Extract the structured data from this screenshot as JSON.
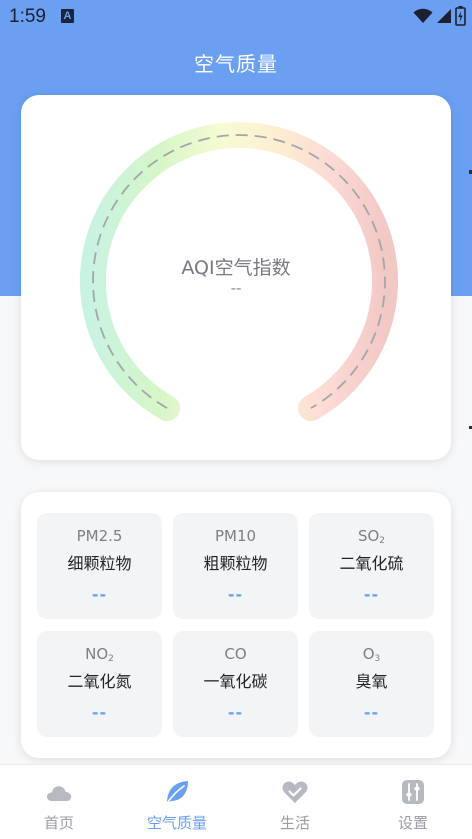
{
  "status_bar": {
    "time": "1:59",
    "notification_glyph": "A",
    "icons": [
      "wifi-icon",
      "signal-icon",
      "battery-icon"
    ]
  },
  "header": {
    "title": "空气质量"
  },
  "gauge": {
    "label": "AQI空气指数",
    "value": "--",
    "gradient_colors": [
      "#c9f3e1",
      "#d6f5c8",
      "#f7fbd3",
      "#fdefd2",
      "#fbd9d4",
      "#f2c8c5"
    ]
  },
  "pollutants": [
    {
      "code": "PM2.5",
      "sub": "",
      "name": "细颗粒物",
      "value": "--"
    },
    {
      "code": "PM10",
      "sub": "",
      "name": "粗颗粒物",
      "value": "--"
    },
    {
      "code": "SO",
      "sub": "2",
      "name": "二氧化硫",
      "value": "--"
    },
    {
      "code": "NO",
      "sub": "2",
      "name": "二氧化氮",
      "value": "--"
    },
    {
      "code": "CO",
      "sub": "",
      "name": "一氧化碳",
      "value": "--"
    },
    {
      "code": "O",
      "sub": "3",
      "name": "臭氧",
      "value": "--"
    }
  ],
  "tabs": [
    {
      "label": "首页",
      "icon": "cloud-icon",
      "active": false
    },
    {
      "label": "空气质量",
      "icon": "leaf-icon",
      "active": true
    },
    {
      "label": "生活",
      "icon": "heart-icon",
      "active": false
    },
    {
      "label": "设置",
      "icon": "sliders-icon",
      "active": false
    }
  ],
  "colors": {
    "accent": "#6a9ff2",
    "inactive": "#9a9da3"
  }
}
